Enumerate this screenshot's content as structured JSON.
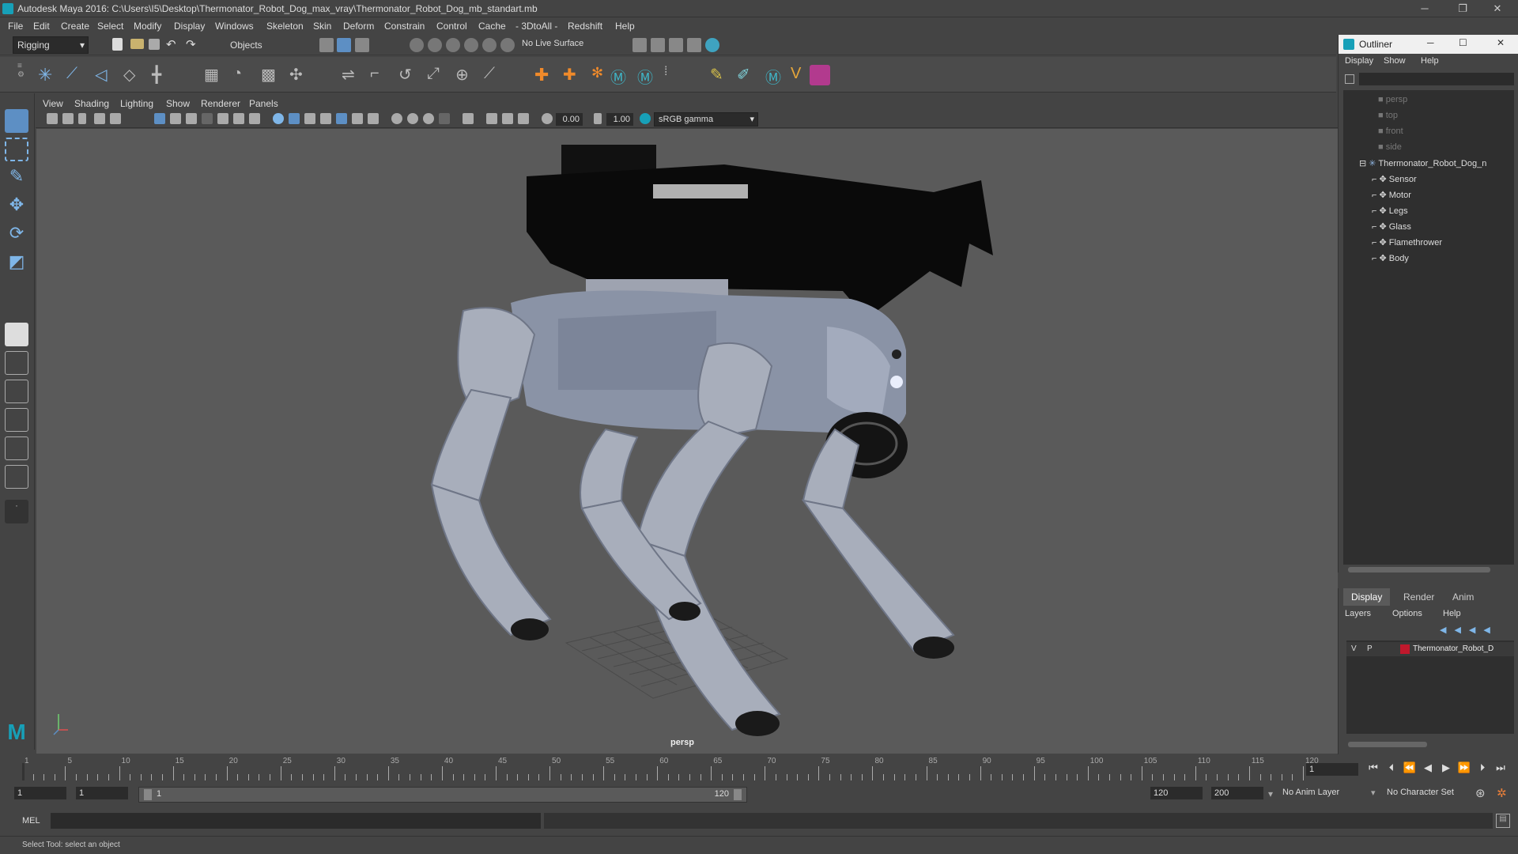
{
  "window": {
    "title": "Autodesk Maya 2016: C:\\Users\\I5\\Desktop\\Thermonator_Robot_Dog_max_vray\\Thermonator_Robot_Dog_mb_standart.mb",
    "minimize": "─",
    "restore": "❐",
    "close": "✕"
  },
  "menubar": [
    "File",
    "Edit",
    "Create",
    "Select",
    "Modify",
    "Display",
    "Windows",
    "Skeleton",
    "Skin",
    "Deform",
    "Constrain",
    "Control",
    "Cache",
    "- 3DtoAll -",
    "Redshift",
    "Help"
  ],
  "statusline": {
    "mode": "Rigging",
    "select_mode": "Objects",
    "live_surface": "No Live Surface"
  },
  "viewport": {
    "menu": [
      "View",
      "Shading",
      "Lighting",
      "Show",
      "Renderer",
      "Panels"
    ],
    "gamma_a": "0.00",
    "gamma_b": "1.00",
    "color_space": "sRGB gamma",
    "camera_label": "persp"
  },
  "timeline": {
    "ticks": [
      "1",
      "5",
      "10",
      "15",
      "20",
      "25",
      "30",
      "35",
      "40",
      "45",
      "50",
      "55",
      "60",
      "65",
      "70",
      "75",
      "80",
      "85",
      "90",
      "95",
      "100",
      "105",
      "110",
      "115",
      "120"
    ],
    "current_frame": "1"
  },
  "range": {
    "start": "1",
    "playback_start": "1",
    "slider_start": "1",
    "slider_end": "120",
    "playback_end": "120",
    "end": "200",
    "anim_layer": "No Anim Layer",
    "char_set": "No Character Set"
  },
  "cmdline": {
    "lang": "MEL"
  },
  "helpline": "Select Tool: select an object",
  "outliner": {
    "title": "Outliner",
    "menu": [
      "Display",
      "Show",
      "Help"
    ],
    "cameras": [
      "persp",
      "top",
      "front",
      "side"
    ],
    "root": "Thermonator_Robot_Dog_n",
    "children": [
      "Sensor",
      "Motor",
      "Legs",
      "Glass",
      "Flamethrower",
      "Body"
    ]
  },
  "layers": {
    "tabs": [
      "Display",
      "Render",
      "Anim"
    ],
    "menu": [
      "Layers",
      "Options",
      "Help"
    ],
    "row": {
      "v": "V",
      "p": "P",
      "name": "Thermonator_Robot_D",
      "color": "#c0182c"
    }
  },
  "colors": {
    "accent": "#17a0b8",
    "selected_tool": "#5d8fc4"
  }
}
